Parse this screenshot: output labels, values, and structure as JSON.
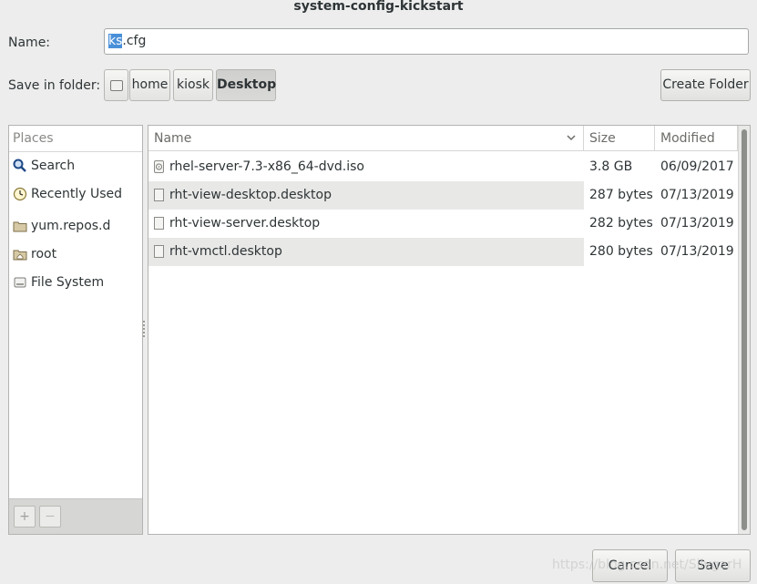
{
  "window": {
    "title": "system-config-kickstart"
  },
  "name_field": {
    "label": "Name:",
    "value_selected": "ks",
    "value_rest": ".cfg"
  },
  "folder": {
    "label": "Save in folder:",
    "path": [
      "home",
      "kiosk",
      "Desktop"
    ],
    "active": "Desktop",
    "create_folder_label": "Create Folder"
  },
  "places": {
    "header": "Places",
    "items": [
      {
        "label": "Search",
        "icon": "search-icon"
      },
      {
        "label": "Recently Used",
        "icon": "clock-icon"
      },
      {
        "label": "yum.repos.d",
        "icon": "folder-icon"
      },
      {
        "label": "root",
        "icon": "home-folder-icon"
      },
      {
        "label": "File System",
        "icon": "drive-icon"
      }
    ],
    "add_label": "+",
    "remove_label": "—"
  },
  "files": {
    "columns": {
      "name": "Name",
      "size": "Size",
      "modified": "Modified"
    },
    "rows": [
      {
        "name": "rhel-server-7.3-x86_64-dvd.iso",
        "size": "3.8 GB",
        "modified": "06/09/2017",
        "icon": "disc-image-icon"
      },
      {
        "name": "rht-view-desktop.desktop",
        "size": "287 bytes",
        "modified": "07/13/2019",
        "icon": "file-icon"
      },
      {
        "name": "rht-view-server.desktop",
        "size": "282 bytes",
        "modified": "07/13/2019",
        "icon": "file-icon"
      },
      {
        "name": "rht-vmctl.desktop",
        "size": "280 bytes",
        "modified": "07/13/2019",
        "icon": "file-icon"
      }
    ]
  },
  "actions": {
    "cancel_label": "Cancel",
    "save_label": "Save"
  },
  "watermark": "https://blog.csdn.net/SilvgarH",
  "colors": {
    "selection": "#4a90d9",
    "background": "#ededed"
  }
}
